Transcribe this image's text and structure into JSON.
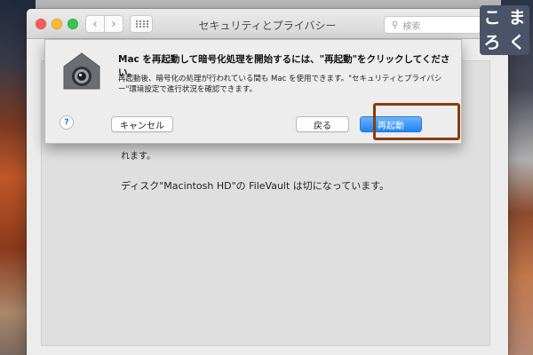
{
  "window": {
    "title": "セキュリティとプライバシー",
    "search_placeholder": "検索"
  },
  "background": {
    "text_line_1": "れます。",
    "text_line_2": "ディスク\"Macintosh HD\"の FileVault は切になっています。"
  },
  "sheet": {
    "title": "Mac を再起動して暗号化処理を開始するには、\"再起動\"をクリックしてください。",
    "message": "再起動後、暗号化の処理が行われている間も Mac を使用できます。\"セキュリティとプライバシー\"環境設定で進行状況を確認できます。",
    "help_label": "?",
    "cancel_label": "キャンセル",
    "back_label": "戻る",
    "restart_label": "再起動"
  },
  "brand": {
    "chars": [
      "こ",
      "ま",
      "ろ",
      "く"
    ]
  },
  "colors": {
    "highlight": "#8b3b0b",
    "primary_button": "#1f83f1",
    "brand_bg": "#4a5368"
  }
}
